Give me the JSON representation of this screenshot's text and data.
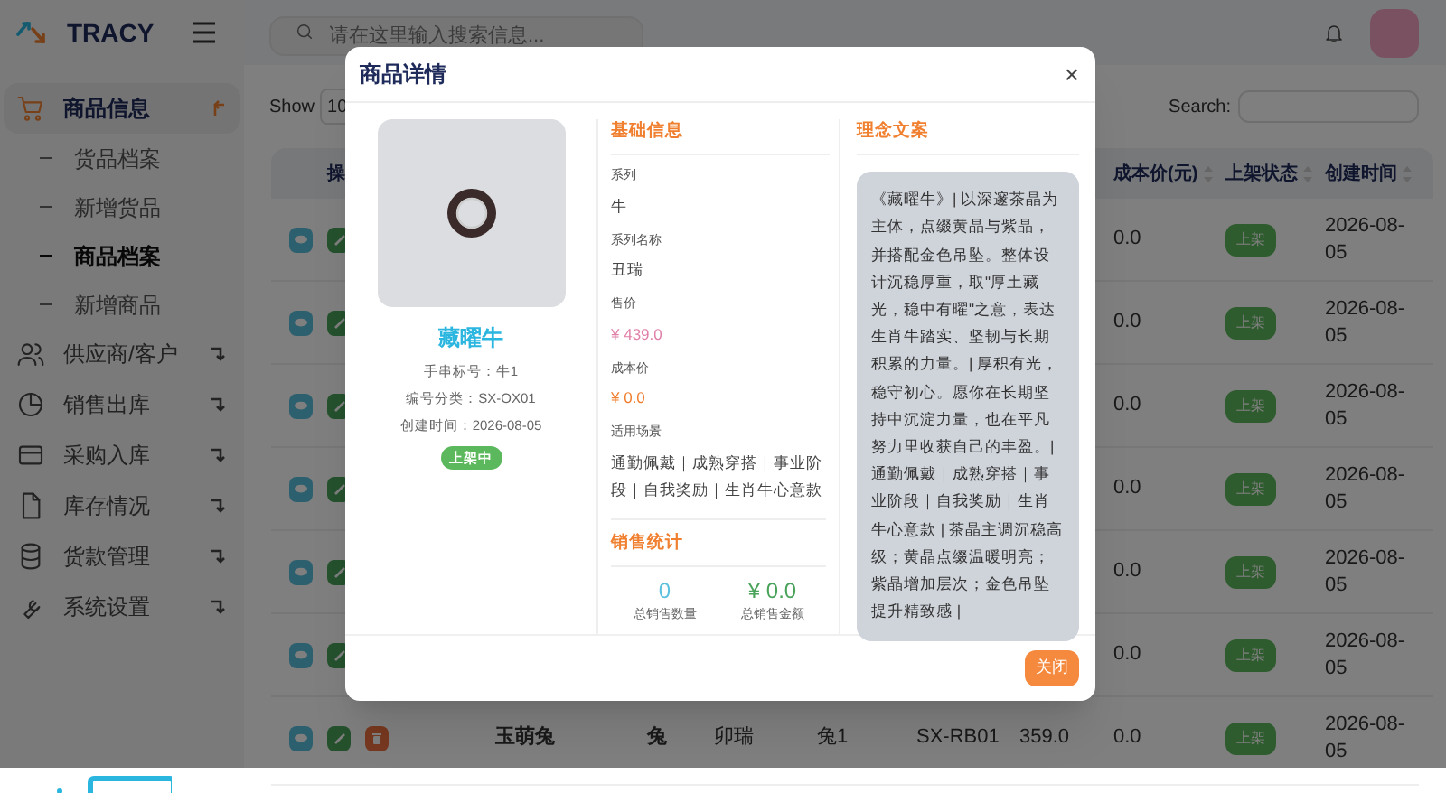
{
  "brand": "TRACY",
  "sidebar": {
    "items": [
      {
        "label": "商品信息",
        "kind": "cart",
        "selected": true,
        "expanded": true,
        "children": [
          {
            "label": "货品档案",
            "selected": false
          },
          {
            "label": "新增货品",
            "selected": false
          },
          {
            "label": "商品档案",
            "selected": true
          },
          {
            "label": "新增商品",
            "selected": false
          }
        ]
      },
      {
        "label": "供应商/客户",
        "kind": "users",
        "selected": false,
        "expanded": false
      },
      {
        "label": "销售出库",
        "kind": "pie",
        "selected": false,
        "expanded": false
      },
      {
        "label": "采购入库",
        "kind": "card",
        "selected": false,
        "expanded": false
      },
      {
        "label": "库存情况",
        "kind": "file",
        "selected": false,
        "expanded": false
      },
      {
        "label": "货款管理",
        "kind": "database",
        "selected": false,
        "expanded": false
      },
      {
        "label": "系统设置",
        "kind": "wrench",
        "selected": false,
        "expanded": false
      }
    ]
  },
  "search": {
    "placeholder": "请在这里输入搜索信息..."
  },
  "table": {
    "show_label": "Show",
    "show_value": "10",
    "search_label": "Search:",
    "columns": [
      {
        "label": "操"
      },
      {
        "label": "成本价(元)"
      },
      {
        "label": "上架状态"
      },
      {
        "label": "创建时间"
      }
    ],
    "rows": [
      {
        "cost": "0.0",
        "status": "上架",
        "created": "2026-08-05"
      },
      {
        "cost": "0.0",
        "status": "上架",
        "created": "2026-08-05"
      },
      {
        "cost": "0.0",
        "status": "上架",
        "created": "2026-08-05"
      },
      {
        "cost": "0.0",
        "status": "上架",
        "created": "2026-08-05"
      },
      {
        "cost": "0.0",
        "status": "上架",
        "created": "2026-08-05"
      },
      {
        "cost": "0.0",
        "status": "上架",
        "created": "2026-08-05"
      },
      {
        "name": "玉萌兔",
        "series": "兔",
        "series_name": "卯瑞",
        "bead_no": "兔1",
        "code": "SX-RB01",
        "price": "359.0",
        "cost": "0.0",
        "status": "上架",
        "created": "2026-08-05"
      }
    ]
  },
  "modal": {
    "title": "商品详情",
    "close": "×",
    "product": {
      "name": "藏曜牛",
      "lines": [
        "手串标号：牛1",
        "编号分类：SX-OX01",
        "创建时间：2026-08-05"
      ],
      "status": "上架中"
    },
    "basic": {
      "title": "基础信息",
      "fields": [
        {
          "label": "系列",
          "value": "牛",
          "kind": "plain"
        },
        {
          "label": "系列名称",
          "value": "丑瑞",
          "kind": "plain"
        },
        {
          "label": "售价",
          "value": "¥ 439.0",
          "kind": "price"
        },
        {
          "label": "成本价",
          "value": "¥ 0.0",
          "kind": "cost"
        },
        {
          "label": "适用场景",
          "value": "通勤佩戴｜成熟穿搭｜事业阶段｜自我奖励｜生肖牛心意款",
          "kind": "plain"
        }
      ]
    },
    "stats": {
      "title": "销售统计",
      "items": [
        {
          "value": "0",
          "label": "总销售数量",
          "kind": "count"
        },
        {
          "value": "¥ 0.0",
          "label": "总销售金额",
          "kind": "amount"
        }
      ]
    },
    "concept": {
      "title": "理念文案",
      "text": "《藏曜牛》| 以深邃茶晶为主体，点缀黄晶与紫晶，并搭配金色吊坠。整体设计沉稳厚重，取\"厚土藏光，稳中有曜\"之意，表达生肖牛踏实、坚韧与长期积累的力量。| 厚积有光，稳守初心。愿你在长期坚持中沉淀力量，也在平凡努力里收获自己的丰盈。| 通勤佩戴｜成熟穿搭｜事业阶段｜自我奖励｜生肖牛心意款 | 茶晶主调沉稳高级；黄晶点缀温暖明亮；紫晶增加层次；金色吊坠提升精致感 |"
    },
    "footer_button": "关闭"
  }
}
